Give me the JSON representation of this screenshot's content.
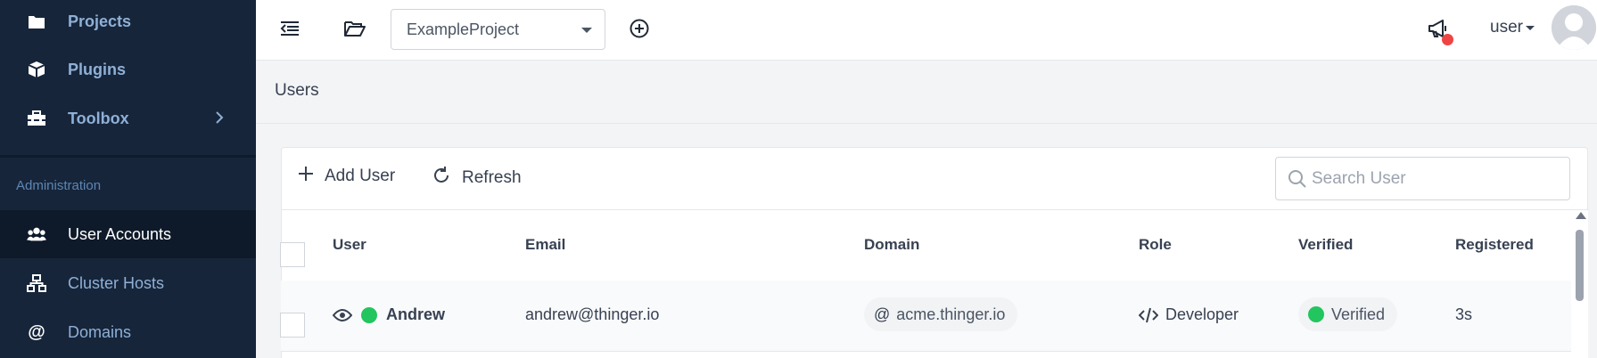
{
  "sidebar": {
    "items": [
      {
        "label": "Projects",
        "icon": "folder-icon"
      },
      {
        "label": "Plugins",
        "icon": "cube-icon"
      },
      {
        "label": "Toolbox",
        "icon": "toolbox-icon"
      }
    ],
    "section_title": "Administration",
    "admin_items": [
      {
        "label": "User Accounts",
        "icon": "users-icon",
        "active": true
      },
      {
        "label": "Cluster Hosts",
        "icon": "sitemap-icon"
      },
      {
        "label": "Domains",
        "icon": "at-icon"
      }
    ]
  },
  "topbar": {
    "project_selected": "ExampleProject",
    "user_label": "user"
  },
  "page": {
    "title": "Users"
  },
  "toolbar": {
    "add_label": "Add User",
    "refresh_label": "Refresh",
    "search_placeholder": "Search User"
  },
  "table": {
    "columns": [
      "User",
      "Email",
      "Domain",
      "Role",
      "Verified",
      "Registered"
    ],
    "rows": [
      {
        "user": "Andrew",
        "email": "andrew@thinger.io",
        "domain": "acme.thinger.io",
        "role": "Developer",
        "verified": "Verified",
        "registered": "3s"
      }
    ]
  },
  "colors": {
    "sidebar_bg": "#16253a",
    "sidebar_text": "#8fb0d6",
    "status_green": "#22c55e",
    "notification_red": "#ef4444"
  }
}
